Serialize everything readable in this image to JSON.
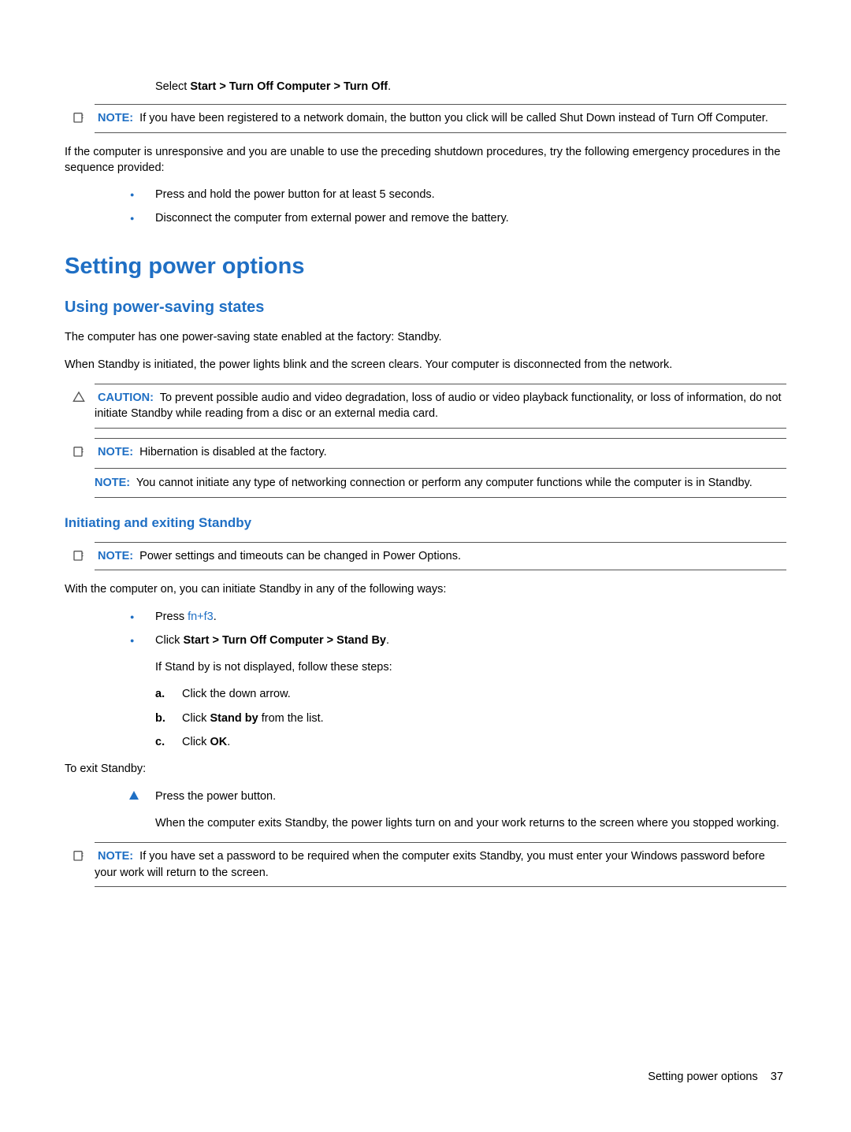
{
  "topline_prefix": "Select ",
  "topline_bold": "Start > Turn Off Computer > Turn Off",
  "topline_suffix": ".",
  "note1_label": "NOTE:",
  "note1_text": "If you have been registered to a network domain, the button you click will be called Shut Down instead of Turn Off Computer.",
  "para_unresponsive": "If the computer is unresponsive and you are unable to use the preceding shutdown procedures, try the following emergency procedures in the sequence provided:",
  "bullet_a1": "Press and hold the power button for at least 5 seconds.",
  "bullet_a2": "Disconnect the computer from external power and remove the battery.",
  "h1": "Setting power options",
  "h2": "Using power-saving states",
  "para_factory": "The computer has one power-saving state enabled at the factory: Standby.",
  "para_initiated": "When Standby is initiated, the power lights blink and the screen clears. Your computer is disconnected from the network.",
  "caution_label": "CAUTION:",
  "caution_text": "To prevent possible audio and video degradation, loss of audio or video playback functionality, or loss of information, do not initiate Standby while reading from a disc or an external media card.",
  "note2a_label": "NOTE:",
  "note2a_text": "Hibernation is disabled at the factory.",
  "note2b_label": "NOTE:",
  "note2b_text": "You cannot initiate any type of networking connection or perform any computer functions while the computer is in Standby.",
  "h3": "Initiating and exiting Standby",
  "note3_label": "NOTE:",
  "note3_text": "Power settings and timeouts can be changed in Power Options.",
  "para_withon": "With the computer on, you can initiate Standby in any of the following ways:",
  "bullet_b1_pre": "Press ",
  "bullet_b1_key": "fn+f3",
  "bullet_b1_post": ".",
  "bullet_b2_pre": "Click ",
  "bullet_b2_bold": "Start > Turn Off Computer > Stand By",
  "bullet_b2_post": ".",
  "para_ifnot": "If Stand by is not displayed, follow these steps:",
  "letters": {
    "a_marker": "a.",
    "a_text": "Click the down arrow.",
    "b_marker": "b.",
    "b_pre": "Click ",
    "b_bold": "Stand by",
    "b_post": " from the list.",
    "c_marker": "c.",
    "c_pre": "Click ",
    "c_bold": "OK",
    "c_post": "."
  },
  "para_exit": "To exit Standby:",
  "tri_text": "Press the power button.",
  "para_exit2": "When the computer exits Standby, the power lights turn on and your work returns to the screen where you stopped working.",
  "note4_label": "NOTE:",
  "note4_text": "If you have set a password to be required when the computer exits Standby, you must enter your Windows password before your work will return to the screen.",
  "footer_text": "Setting power options",
  "footer_page": "37"
}
